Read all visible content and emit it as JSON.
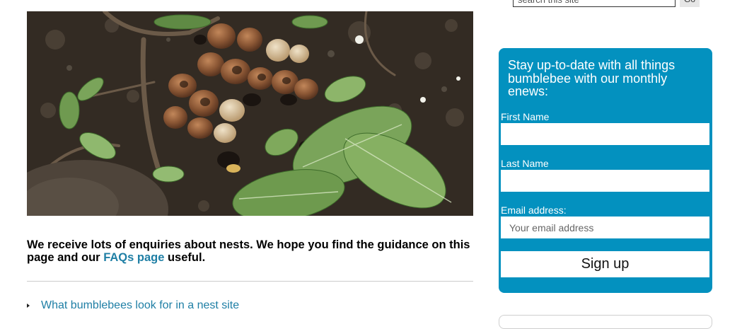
{
  "search": {
    "placeholder": "search this site",
    "button_label": "Go"
  },
  "hero": {
    "alt": "Bumblebee nest among leaves and soil"
  },
  "intro": {
    "text_before": "We receive lots of enquiries about nests. We hope you find the guidance on this page and our ",
    "link_text": "FAQs page",
    "text_after": " useful."
  },
  "toc": {
    "items": [
      {
        "label": "What bumblebees look for in a nest site"
      }
    ]
  },
  "signup": {
    "heading": "Stay up-to-date with all things bumblebee with our monthly enews:",
    "first_name_label": "First Name",
    "last_name_label": "Last Name",
    "email_label": "Email address:",
    "email_placeholder": "Your email address",
    "button_label": "Sign up"
  },
  "colors": {
    "accent": "#0391bf",
    "link": "#1f7fa5",
    "divider": "#cccccc"
  }
}
